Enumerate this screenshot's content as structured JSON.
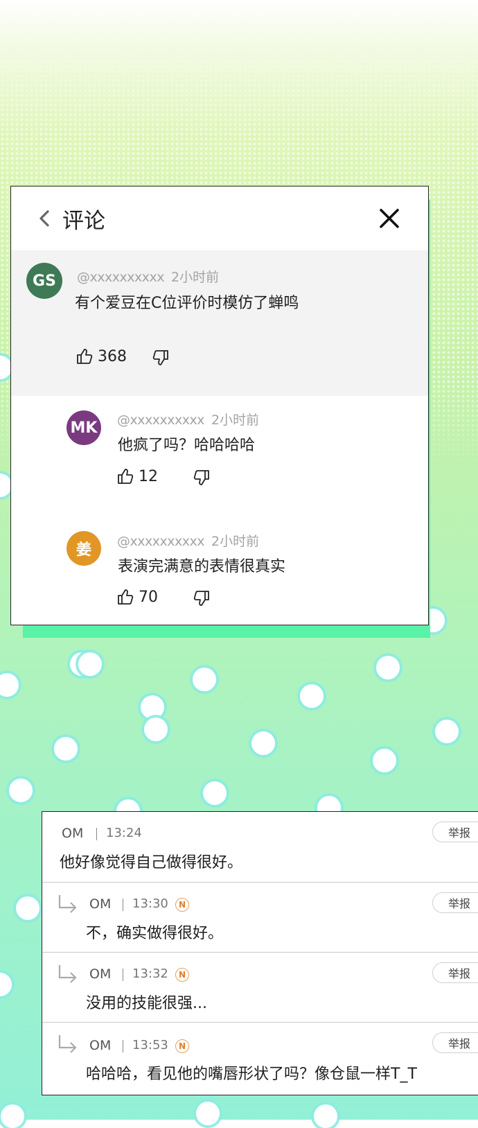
{
  "youtube_panel": {
    "title": "评论",
    "comments": [
      {
        "avatar_text": "GS",
        "avatar_color": "#3e7a55",
        "handle": "@xxxxxxxxxx",
        "time": "2小时前",
        "text": "有个爱豆在C位评价时模仿了蝉鸣",
        "likes": "368"
      },
      {
        "avatar_text": "MK",
        "avatar_color": "#7a3a80",
        "handle": "@xxxxxxxxxx",
        "time": "2小时前",
        "text": "他疯了吗？哈哈哈哈",
        "likes": "12"
      },
      {
        "avatar_text": "姜",
        "avatar_color": "#e19626",
        "handle": "@xxxxxxxxxx",
        "time": "2小时前",
        "text": "表演完满意的表情很真实",
        "likes": "70"
      }
    ]
  },
  "forum_panel": {
    "report_label": "举报",
    "badge_letter": "N",
    "posts": [
      {
        "name": "OM",
        "time": "13:24",
        "text": "他好像觉得自己做得很好。",
        "reply": false
      },
      {
        "name": "OM",
        "time": "13:30",
        "text": "不，确实做得很好。",
        "reply": true
      },
      {
        "name": "OM",
        "time": "13:32",
        "text": "没用的技能很强...",
        "reply": true
      },
      {
        "name": "OM",
        "time": "13:53",
        "text": "哈哈哈，看见他的嘴唇形状了吗？像仓鼠一样T_T",
        "reply": true
      }
    ]
  },
  "colors": {
    "accent_green": "#58f3a6",
    "badge_orange": "#e07d2a"
  }
}
